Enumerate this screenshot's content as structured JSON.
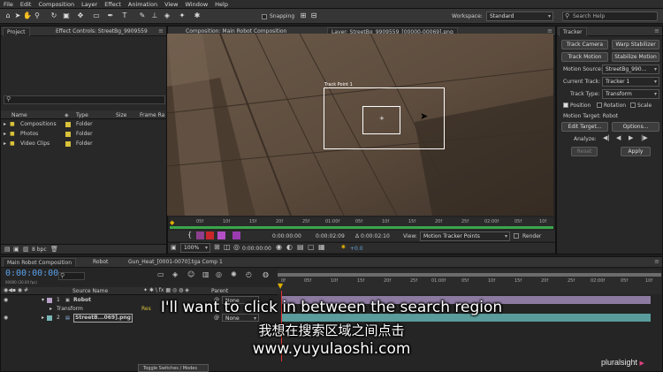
{
  "menu": [
    "File",
    "Edit",
    "Composition",
    "Layer",
    "Effect",
    "Animation",
    "View",
    "Window",
    "Help"
  ],
  "toolbar": {
    "snapping_label": "Snapping",
    "workspace_label": "Workspace:",
    "workspace_value": "Standard",
    "search_placeholder": "Search Help"
  },
  "project": {
    "tabs": [
      "Project",
      "Effect Controls: StreetBg_9909559"
    ],
    "search_icon": "search-icon",
    "columns": [
      "Name",
      "Type",
      "Size",
      "Frame Ra"
    ],
    "items": [
      {
        "name": "Compositions",
        "type": "Folder"
      },
      {
        "name": "Photos",
        "type": "Folder"
      },
      {
        "name": "Video Clips",
        "type": "Folder"
      }
    ],
    "bpc": "8 bpc"
  },
  "viewer": {
    "tabs": [
      "Composition: Main Robot Composition",
      "Layer: StreetBg_9909559_[00000-00069].png"
    ],
    "track_point_label": "Track Point 1",
    "ruler_ticks": [
      "00f",
      "05f",
      "10f",
      "15f",
      "20f",
      "25f",
      "01:00f",
      "05f",
      "10f",
      "15f",
      "20f",
      "25f",
      "02:00f",
      "05f",
      "10f"
    ],
    "time_current": "0:00:00:00",
    "time_end": "0:00:02:09",
    "time_duration": "Δ 0:00:02:10",
    "view_label": "View:",
    "view_value": "Motion Tracker Points",
    "render_label": "Render",
    "zoom": "100%",
    "time_bottom": "0:00:00:00",
    "exposure": "+0.0"
  },
  "tracker": {
    "tab": "Tracker",
    "track_camera": "Track Camera",
    "warp_stabilizer": "Warp Stabilizer",
    "track_motion": "Track Motion",
    "stabilize_motion": "Stabilize Motion",
    "motion_source_label": "Motion Source:",
    "motion_source_value": "StreetBg_990...",
    "current_track_label": "Current Track:",
    "current_track_value": "Tracker 1",
    "track_type_label": "Track Type:",
    "track_type_value": "Transform",
    "position_label": "Position",
    "rotation_label": "Rotation",
    "scale_label": "Scale",
    "motion_target": "Motion Target: Robot",
    "edit_target": "Edit Target...",
    "options": "Options...",
    "analyze_label": "Analyze:",
    "reset": "Reset",
    "apply": "Apply"
  },
  "timeline": {
    "tabs": [
      "Main Robot Composition",
      "Robot",
      "Gun_Heat_[0001-0070].tga Comp 1"
    ],
    "timecode": "0:00:00:00",
    "timecode_sub": "00000 (30.00 fps)",
    "col_source": "Source Name",
    "col_parent": "Parent",
    "layers": [
      {
        "num": "1",
        "name": "Robot",
        "parent": "None"
      },
      {
        "num": "",
        "name": "Transform",
        "extra": "Res"
      },
      {
        "num": "2",
        "name": "StreetB...069].png",
        "parent": "None"
      }
    ],
    "ruler_ticks": [
      "0f",
      "05f",
      "10f",
      "15f",
      "20f",
      "25f",
      "01:00f",
      "05f",
      "10f",
      "15f",
      "20f",
      "25f",
      "02:00f",
      "05f",
      "10f"
    ],
    "toggle_label": "Toggle Switches / Modes"
  },
  "subtitles": {
    "english": "I'll want to click in between the search region",
    "chinese": "我想在搜索区域之间点击",
    "url": "www.yuyulaoshi.com"
  },
  "watermark": "pluralsight"
}
